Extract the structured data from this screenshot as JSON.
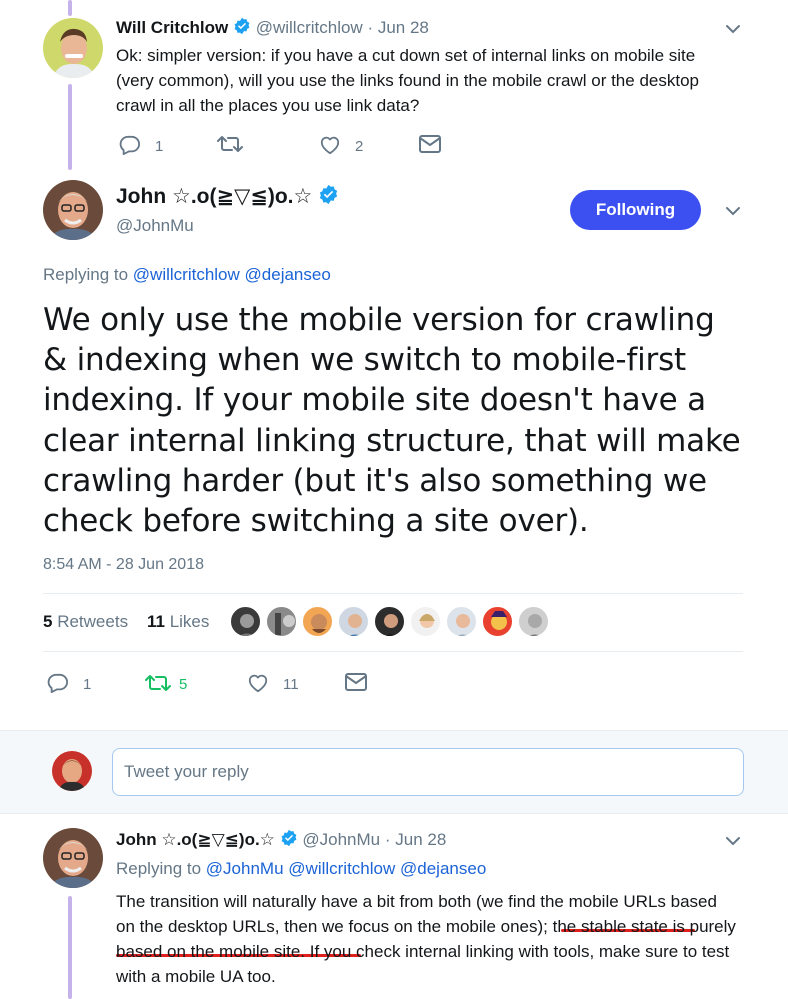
{
  "colors": {
    "accent": "#3c4ff0",
    "link": "#1b63d6",
    "retweet_green": "#17bf63",
    "muted": "#657786",
    "thread_line": "#c6b2ea",
    "highlight_underline": "#e0201d"
  },
  "tweet1": {
    "author_name": "Will Critchlow",
    "handle": "@willcritchlow",
    "date": "· Jun 28",
    "text": "Ok: simpler version: if you have a cut down set of internal links on mobile site (very common), will you use the links found in the mobile crawl or the desktop crawl in all the places you use link data?",
    "reply_count": "1",
    "retweet_count": "",
    "like_count": "2"
  },
  "main_tweet": {
    "author_name": "John ☆.o(≧▽≦)o.☆",
    "handle": "@JohnMu",
    "follow_label": "Following",
    "replying_prefix": "Replying to",
    "replying_users": [
      "@willcritchlow",
      "@dejanseo"
    ],
    "text": "We only use the mobile version for crawling & indexing when we switch to mobile-first indexing. If your mobile site doesn't have a clear internal linking structure, that will make crawling harder (but it's also something we check before switching a site over).",
    "timestamp": "8:54 AM - 28 Jun 2018",
    "retweets_num": "5",
    "retweets_label": "Retweets",
    "likes_num": "11",
    "likes_label": "Likes",
    "liker_avatars": 10,
    "reply_count": "1",
    "retweet_count": "5",
    "like_count": "11"
  },
  "reply_box": {
    "placeholder": "Tweet your reply"
  },
  "tweet3": {
    "author_name": "John ☆.o(≧▽≦)o.☆",
    "handle": "@JohnMu",
    "date": "· Jun 28",
    "replying_prefix": "Replying to",
    "replying_users": [
      "@JohnMu",
      "@willcritchlow",
      "@dejanseo"
    ],
    "text_before": "The transition will naturally have a bit from both (we find the mobile URLs based on the desktop URLs, then we focus on the mobile ones); ",
    "text_highlight": "the stable state is purely based on the mobile site",
    "text_after": ". If you check internal linking with tools, make sure to test with a mobile UA too."
  },
  "icons": [
    "reply-icon",
    "retweet-icon",
    "heart-icon",
    "mail-icon",
    "verified-badge-icon",
    "chevron-down-icon"
  ]
}
